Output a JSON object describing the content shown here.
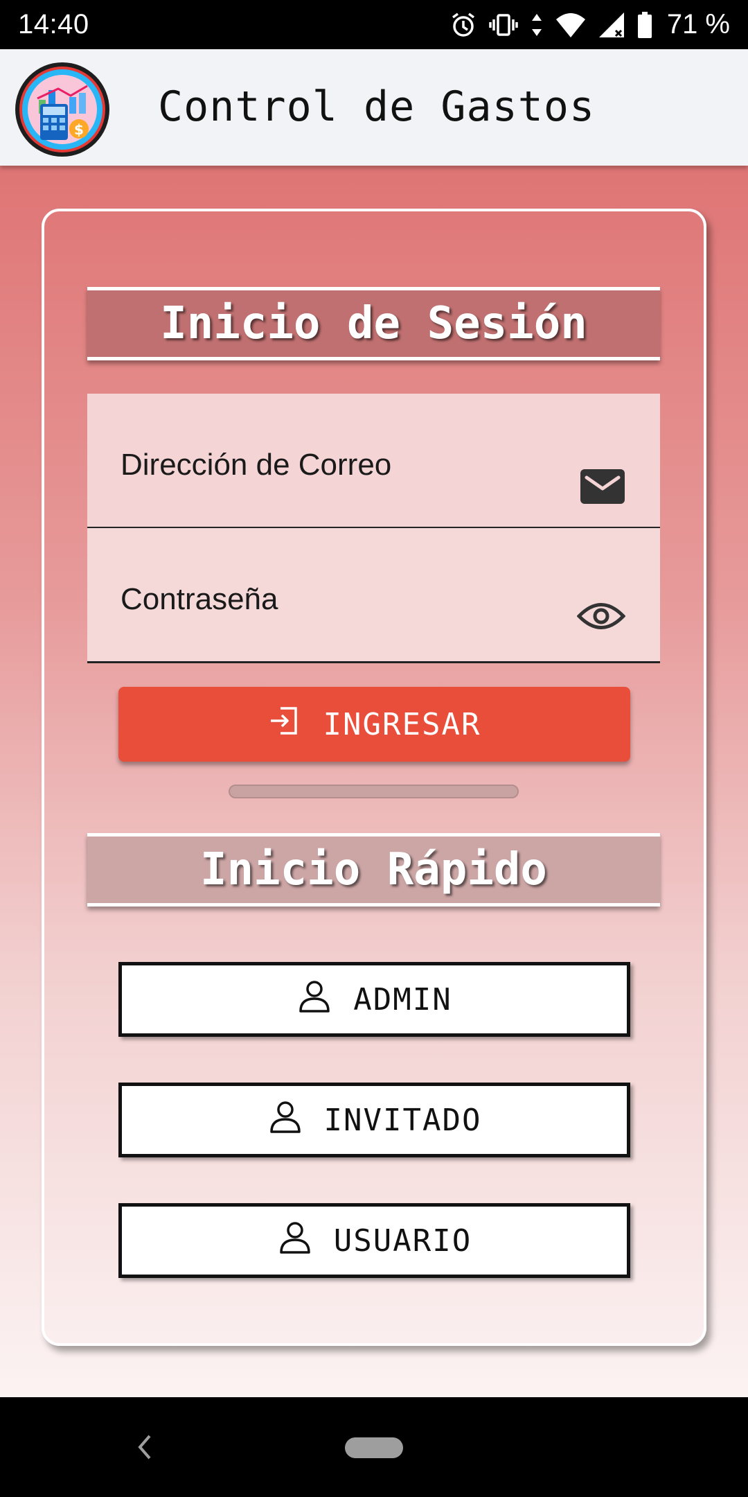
{
  "status_bar": {
    "time": "14:40",
    "battery_percent": "71 %",
    "icons": [
      "alarm-icon",
      "vibrate-icon",
      "data-arrows-icon",
      "wifi-icon",
      "signal-icon",
      "battery-icon"
    ]
  },
  "app_bar": {
    "title": "Control de Gastos",
    "logo_icon": "finance-calculator-logo"
  },
  "login": {
    "header": "Inicio de Sesión",
    "email_label": "Dirección de Correo",
    "password_label": "Contraseña",
    "submit_label": "INGRESAR"
  },
  "quick_start": {
    "header": "Inicio Rápido",
    "buttons": [
      "ADMIN",
      "INVITADO",
      "USUARIO"
    ]
  },
  "colors": {
    "accent": "#e94e3b",
    "gradient_top": "#df7575",
    "gradient_bottom": "#fcf3f3",
    "header_login_bg": "#c07070",
    "header_quick_bg": "#cca5a5"
  }
}
